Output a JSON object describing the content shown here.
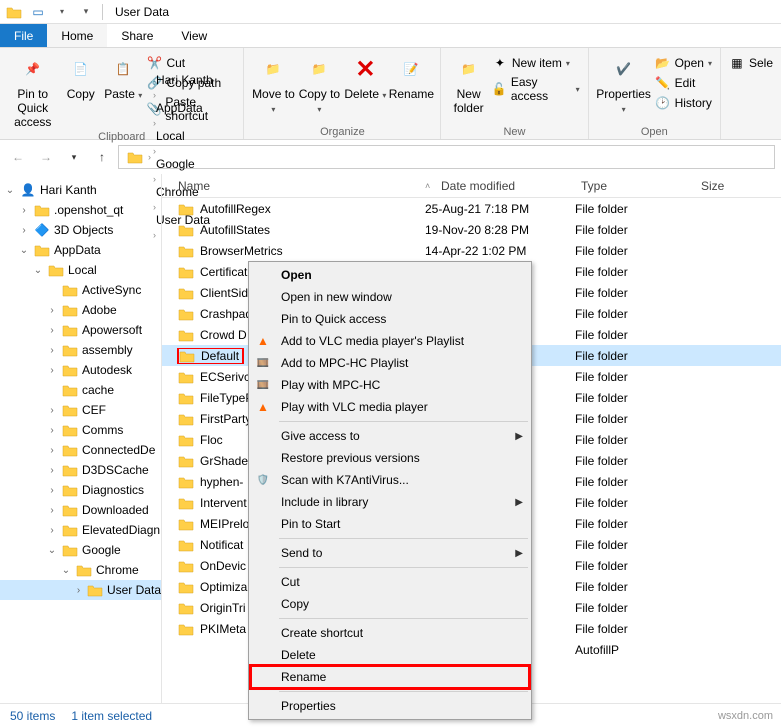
{
  "titlebar": {
    "title": "User Data"
  },
  "tabs": {
    "file": "File",
    "home": "Home",
    "share": "Share",
    "view": "View"
  },
  "ribbon": {
    "clipboard": {
      "label": "Clipboard",
      "pin": "Pin to Quick access",
      "copy": "Copy",
      "paste": "Paste",
      "cut": "Cut",
      "copypath": "Copy path",
      "pasteshortcut": "Paste shortcut"
    },
    "organize": {
      "label": "Organize",
      "moveto": "Move to",
      "copyto": "Copy to",
      "delete": "Delete",
      "rename": "Rename"
    },
    "new": {
      "label": "New",
      "newfolder": "New folder",
      "newitem": "New item",
      "easyaccess": "Easy access"
    },
    "open": {
      "label": "Open",
      "properties": "Properties",
      "open": "Open",
      "edit": "Edit",
      "history": "History"
    },
    "select": {
      "all": "Sele"
    }
  },
  "breadcrumb": [
    "Hari Kanth",
    "AppData",
    "Local",
    "Google",
    "Chrome",
    "User Data"
  ],
  "navpane": [
    {
      "depth": 0,
      "icon": "user",
      "label": "Hari Kanth",
      "exp": "v"
    },
    {
      "depth": 1,
      "icon": "folder",
      "label": ".openshot_qt",
      "exp": ">"
    },
    {
      "depth": 1,
      "icon": "3d",
      "label": "3D Objects",
      "exp": ">"
    },
    {
      "depth": 1,
      "icon": "folder",
      "label": "AppData",
      "exp": "v"
    },
    {
      "depth": 2,
      "icon": "folder",
      "label": "Local",
      "exp": "v"
    },
    {
      "depth": 3,
      "icon": "folder",
      "label": "ActiveSync",
      "exp": ""
    },
    {
      "depth": 3,
      "icon": "folder",
      "label": "Adobe",
      "exp": ">"
    },
    {
      "depth": 3,
      "icon": "folder",
      "label": "Apowersoft",
      "exp": ">"
    },
    {
      "depth": 3,
      "icon": "folder",
      "label": "assembly",
      "exp": ">"
    },
    {
      "depth": 3,
      "icon": "folder",
      "label": "Autodesk",
      "exp": ">"
    },
    {
      "depth": 3,
      "icon": "folder",
      "label": "cache",
      "exp": ""
    },
    {
      "depth": 3,
      "icon": "folder",
      "label": "CEF",
      "exp": ">"
    },
    {
      "depth": 3,
      "icon": "folder",
      "label": "Comms",
      "exp": ">"
    },
    {
      "depth": 3,
      "icon": "folder",
      "label": "ConnectedDe",
      "exp": ">"
    },
    {
      "depth": 3,
      "icon": "folder",
      "label": "D3DSCache",
      "exp": ">"
    },
    {
      "depth": 3,
      "icon": "folder",
      "label": "Diagnostics",
      "exp": ">"
    },
    {
      "depth": 3,
      "icon": "folder",
      "label": "Downloaded",
      "exp": ">"
    },
    {
      "depth": 3,
      "icon": "folder",
      "label": "ElevatedDiagn",
      "exp": ">"
    },
    {
      "depth": 3,
      "icon": "folder",
      "label": "Google",
      "exp": "v"
    },
    {
      "depth": 4,
      "icon": "folder",
      "label": "Chrome",
      "exp": "v"
    },
    {
      "depth": 5,
      "icon": "folder",
      "label": "User Data",
      "exp": ">",
      "sel": true
    }
  ],
  "columns": {
    "name": "Name",
    "date": "Date modified",
    "type": "Type",
    "size": "Size"
  },
  "rows": [
    {
      "name": "AutofillRegex",
      "date": "25-Aug-21 7:18 PM",
      "type": "File folder"
    },
    {
      "name": "AutofillStates",
      "date": "19-Nov-20 8:28 PM",
      "type": "File folder"
    },
    {
      "name": "BrowserMetrics",
      "date": "14-Apr-22 1:02 PM",
      "type": "File folder"
    },
    {
      "name": "Certificat",
      "date": "",
      "type": "File folder"
    },
    {
      "name": "ClientSid",
      "date": "",
      "type": "File folder"
    },
    {
      "name": "Crashpad",
      "date": "",
      "type": "File folder"
    },
    {
      "name": "Crowd D",
      "date": "",
      "type": "File folder"
    },
    {
      "name": "Default",
      "date": "",
      "type": "File folder",
      "sel": true
    },
    {
      "name": "ECSerivc",
      "date": "",
      "type": "File folder"
    },
    {
      "name": "FileTypeP",
      "date": "",
      "type": "File folder"
    },
    {
      "name": "FirstParty",
      "date": "",
      "type": "File folder"
    },
    {
      "name": "Floc",
      "date": "",
      "type": "File folder"
    },
    {
      "name": "GrShader",
      "date": "",
      "type": "File folder"
    },
    {
      "name": "hyphen-",
      "date": "",
      "type": "File folder"
    },
    {
      "name": "Intervent",
      "date": "",
      "type": "File folder"
    },
    {
      "name": "MEIPrelo",
      "date": "",
      "type": "File folder"
    },
    {
      "name": "Notificat",
      "date": "",
      "type": "File folder"
    },
    {
      "name": "OnDevic",
      "date": "",
      "type": "File folder"
    },
    {
      "name": "Optimiza",
      "date": "",
      "type": "File folder"
    },
    {
      "name": "OriginTri",
      "date": "",
      "type": "File folder"
    },
    {
      "name": "PKIMeta",
      "date": "",
      "type": "File folder"
    },
    {
      "name": "",
      "date": "",
      "type": "AutofillP"
    }
  ],
  "context_menu": [
    {
      "label": "Open",
      "bold": true
    },
    {
      "label": "Open in new window"
    },
    {
      "label": "Pin to Quick access"
    },
    {
      "label": "Add to VLC media player's Playlist",
      "icon": "vlc"
    },
    {
      "label": "Add to MPC-HC Playlist",
      "icon": "mpc"
    },
    {
      "label": "Play with MPC-HC",
      "icon": "mpc"
    },
    {
      "label": "Play with VLC media player",
      "icon": "vlc"
    },
    {
      "sep": true
    },
    {
      "label": "Give access to",
      "sub": true
    },
    {
      "label": "Restore previous versions"
    },
    {
      "label": "Scan with K7AntiVirus...",
      "icon": "k7"
    },
    {
      "label": "Include in library",
      "sub": true
    },
    {
      "label": "Pin to Start"
    },
    {
      "sep": true
    },
    {
      "label": "Send to",
      "sub": true
    },
    {
      "sep": true
    },
    {
      "label": "Cut"
    },
    {
      "label": "Copy"
    },
    {
      "sep": true
    },
    {
      "label": "Create shortcut"
    },
    {
      "label": "Delete"
    },
    {
      "label": "Rename",
      "highlight": true
    },
    {
      "sep": true
    },
    {
      "label": "Properties"
    }
  ],
  "status": {
    "count": "50 items",
    "selected": "1 item selected"
  },
  "watermark": "wsxdn.com"
}
